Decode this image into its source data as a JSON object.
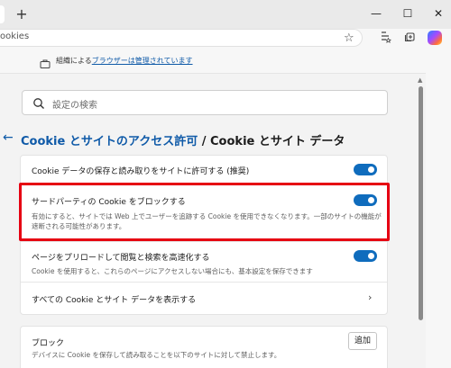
{
  "window": {
    "new_tab_glyph": "+",
    "minimize_glyph": "—",
    "maximize_glyph": "☐",
    "close_glyph": "✕"
  },
  "address": {
    "text": "ookies"
  },
  "infobar": {
    "prefix": "組織による",
    "link": "ブラウザーは管理されています"
  },
  "search": {
    "placeholder": "設定の検索"
  },
  "heading": {
    "crumb": "Cookie とサイトのアクセス許可",
    "separator": " / ",
    "current": "Cookie とサイト データ"
  },
  "settings": [
    {
      "title": "Cookie データの保存と読み取りをサイトに許可する (推奨)",
      "description": "",
      "toggle_on": true
    },
    {
      "title": "サードパーティの Cookie をブロックする",
      "description": "有効にすると、サイトでは Web 上でユーザーを追跡する Cookie を使用できなくなります。一部のサイトの機能が遮断される可能性があります。",
      "toggle_on": true
    },
    {
      "title": "ページをプリロードして閲覧と検索を高速化する",
      "description": "Cookie を使用すると、これらのページにアクセスしない場合にも、基本設定を保存できます",
      "toggle_on": true
    }
  ],
  "see_all": {
    "label": "すべての Cookie とサイト データを表示する"
  },
  "block": {
    "title": "ブロック",
    "description": "デバイスに Cookie を保存して読み取ることを以下のサイトに対して禁止します。",
    "add_label": "追加"
  },
  "colors": {
    "accent": "#0f6cbd",
    "link": "#0f5aa8",
    "highlight": "#e60012"
  }
}
